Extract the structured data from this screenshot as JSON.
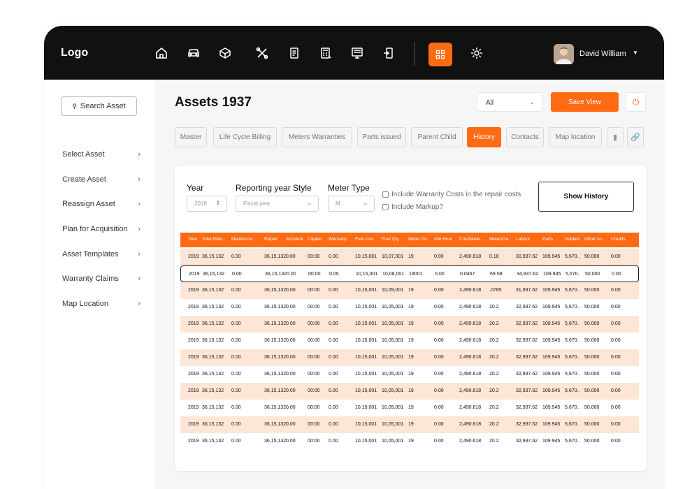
{
  "app": {
    "logo": "Logo",
    "user_name": "David William",
    "accent_color": "#ff6a13"
  },
  "nav": {
    "icons": [
      "home-icon",
      "car-icon",
      "cube-icon",
      "tools-icon",
      "clipboard-icon",
      "calculator-icon",
      "monitor-icon",
      "mobile-transfer-icon",
      "grid-icon",
      "settings-gear-icon"
    ],
    "active": "grid-icon"
  },
  "sidebar": {
    "search_label": "Search Asset",
    "items": [
      {
        "label": "Select Asset"
      },
      {
        "label": "Create Asset"
      },
      {
        "label": "Reassign Asset"
      },
      {
        "label": "Plan for Acquisition"
      },
      {
        "label": "Asset Templates"
      },
      {
        "label": "Warranty Claims"
      },
      {
        "label": "Map Location"
      }
    ]
  },
  "header": {
    "title": "Assets 1937",
    "filter_value": "All",
    "save_view_label": "Save View"
  },
  "tabs": [
    {
      "label": "Master"
    },
    {
      "label": "Life Cycle Billing"
    },
    {
      "label": "Meters Warranties"
    },
    {
      "label": "Parts issued"
    },
    {
      "label": "Parent Child"
    },
    {
      "label": "History",
      "active": true
    },
    {
      "label": "Contacts"
    },
    {
      "label": "Map location"
    }
  ],
  "filters": {
    "year_label": "Year",
    "year_value": "2019",
    "reporting_label": "Reporting year Style",
    "reporting_placeholder": "Fiscal year",
    "meter_label": "Meter Type",
    "meter_value": "M",
    "warranty_label": "Include Warranty Costs in the repair costs",
    "markup_label": "Include Markup?",
    "show_history_label": "Show History"
  },
  "table": {
    "columns": [
      "Year",
      "Total Main..",
      "Maintence..",
      "Repair",
      "Accident",
      "Capital",
      "Warranty",
      "Fuel cost",
      "Fuel Qty",
      "Meter Dri..",
      "Idle Hour",
      "Cost/Mete..",
      "Meter/Ga..",
      "Labour",
      "Parts",
      "Sublets",
      "Other co..",
      "Credits"
    ],
    "rows": [
      [
        "2019",
        "36,15,132",
        "0.00",
        "36,15,132",
        "0.00",
        "00:00",
        "0.00",
        "10,15,001",
        "10,07,001",
        "19",
        "0.00",
        "2,490.618",
        "0.18",
        "30,937.62",
        "109.945",
        "5,670..",
        "50.000",
        "0.00"
      ],
      [
        "2019",
        "36,15,132",
        "0.00",
        "36,15,132",
        "0.00",
        "00:00",
        "0.00",
        "10,15,001",
        "10,08,001",
        "19001",
        "0.00",
        "0.0467",
        "69.08",
        "34,937.62",
        "109.945",
        "5,670..",
        "50.000",
        "0.00"
      ],
      [
        "2019",
        "36,15,132",
        "0.00",
        "36,15,132",
        "0.00",
        "00:00",
        "0.00",
        "10,15,001",
        "10,09,001",
        "19",
        "0.00",
        "2,490.618",
        ".0785",
        "31,937.62",
        "109.945",
        "5,670..",
        "50.000",
        "0.00"
      ],
      [
        "2019",
        "36,15,132",
        "0.00",
        "36,15,132",
        "0.00",
        "00:00",
        "0.00",
        "10,15,001",
        "10,05,001",
        "19",
        "0.00",
        "2,490.618",
        "20.2",
        "32,937.62",
        "109.945",
        "5,670..",
        "50.000",
        "0.00"
      ],
      [
        "2019",
        "36,15,132",
        "0.00",
        "36,15,132",
        "0.00",
        "00:00",
        "0.00",
        "10,15,001",
        "10,05,001",
        "19",
        "0.00",
        "2,490.618",
        "20.2",
        "32,937.62",
        "109.945",
        "5,670..",
        "50.000",
        "0.00"
      ],
      [
        "2019",
        "36,15,132",
        "0.00",
        "36,15,132",
        "0.00",
        "00:00",
        "0.00",
        "10,15,001",
        "10,05,001",
        "19",
        "0.00",
        "2,490.618",
        "20.2",
        "32,937.62",
        "109.945",
        "5,670..",
        "50.000",
        "0.00"
      ],
      [
        "2019",
        "36,15,132",
        "0.00",
        "36,15,132",
        "0.00",
        "00:00",
        "0.00",
        "10,15,001",
        "10,05,001",
        "19",
        "0.00",
        "2,490.618",
        "20.2",
        "32,937.62",
        "109.945",
        "5,670..",
        "50.000",
        "0.00"
      ],
      [
        "2019",
        "36,15,132",
        "0.00",
        "36,15,132",
        "0.00",
        "00:00",
        "0.00",
        "10,15,001",
        "10,05,001",
        "19",
        "0.00",
        "2,490.618",
        "20.2",
        "32,937.62",
        "109.945",
        "5,670..",
        "50.000",
        "0.00"
      ],
      [
        "2019",
        "36,15,132",
        "0.00",
        "36,15,132",
        "0.00",
        "00:00",
        "0.00",
        "10,15,001",
        "10,05,001",
        "19",
        "0.00",
        "2,490.618",
        "20.2",
        "32,937.62",
        "109.945",
        "5,670..",
        "50.000",
        "0.00"
      ],
      [
        "2019",
        "36,15,132",
        "0.00",
        "36,15,132",
        "0.00",
        "00:00",
        "0.00",
        "10,15,001",
        "10,05,001",
        "19",
        "0.00",
        "2,490.618",
        "20.2",
        "32,937.62",
        "109.945",
        "5,670..",
        "50.000",
        "0.00"
      ],
      [
        "2019",
        "36,15,132",
        "0.00",
        "36,15,132",
        "0.00",
        "00:00",
        "0.00",
        "10,15,001",
        "10,05,001",
        "19",
        "0.00",
        "2,490.618",
        "20.2",
        "32,937.62",
        "109.945",
        "5,670..",
        "50.000",
        "0.00"
      ],
      [
        "2019",
        "36,15,132",
        "0.00",
        "36,15,132",
        "0.00",
        "00:00",
        "0.00",
        "10,15,001",
        "10,05,001",
        "19",
        "0.00",
        "2,490.618",
        "20.2",
        "32,937.62",
        "109.945",
        "5,670..",
        "50.000",
        "0.00"
      ]
    ],
    "selected_row": 1
  }
}
